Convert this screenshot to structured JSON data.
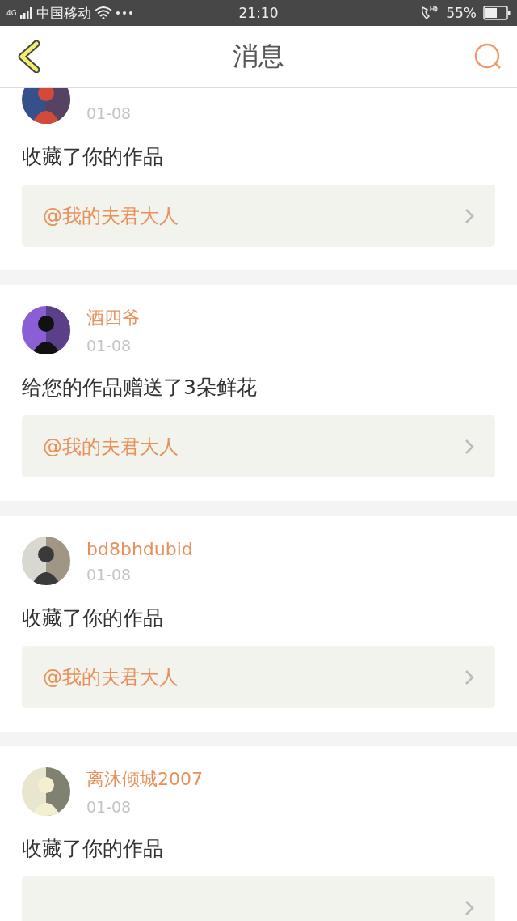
{
  "status_bar": {
    "carrier": "中国移动",
    "network": "4G",
    "time": "21:10",
    "battery": "55%"
  },
  "header": {
    "title": "消息"
  },
  "messages": [
    {
      "date": "01-08",
      "text": "收藏了你的作品",
      "link": "@我的夫君大人"
    },
    {
      "name": "酒四爷",
      "date": "01-08",
      "text": "给您的作品赠送了3朵鲜花",
      "link": "@我的夫君大人"
    },
    {
      "name": "bd8bhdubid",
      "date": "01-08",
      "text": "收藏了你的作品",
      "link": "@我的夫君大人"
    },
    {
      "name": "离沐倾城2007",
      "date": "01-08",
      "text": "收藏了你的作品"
    }
  ]
}
